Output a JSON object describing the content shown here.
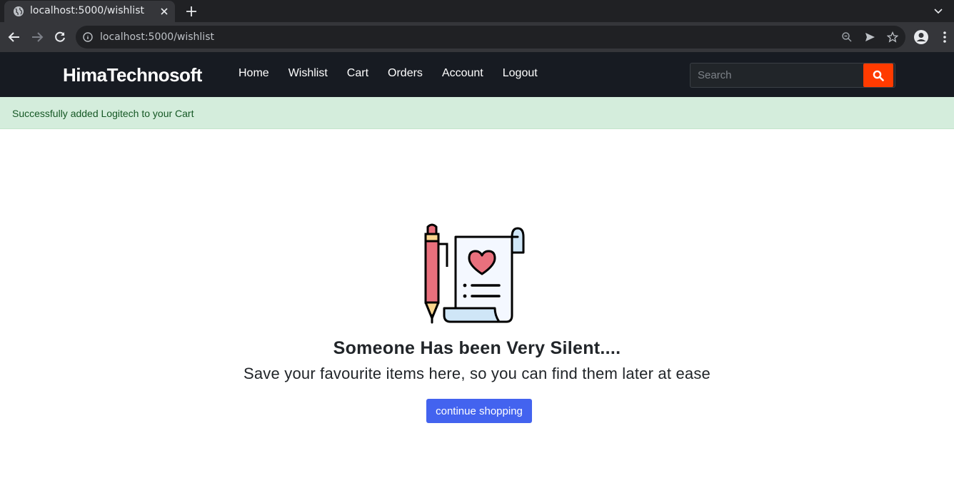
{
  "browser": {
    "tab_title": "localhost:5000/wishlist",
    "url": "localhost:5000/wishlist"
  },
  "navbar": {
    "brand": "HimaTechnosoft",
    "links": [
      "Home",
      "Wishlist",
      "Cart",
      "Orders",
      "Account",
      "Logout"
    ],
    "search_placeholder": "Search",
    "search_button_color": "#ff3b00"
  },
  "alert": {
    "message": "Successfully added Logitech to your Cart",
    "color": "#d4eddc"
  },
  "empty_state": {
    "heading": "Someone Has been Very Silent....",
    "subtext": "Save your favourite items here, so you can find them later at ease",
    "button_label": "continue shopping",
    "button_color": "#4363ef",
    "illustration": "wishlist-pen-scroll-heart-icon"
  }
}
